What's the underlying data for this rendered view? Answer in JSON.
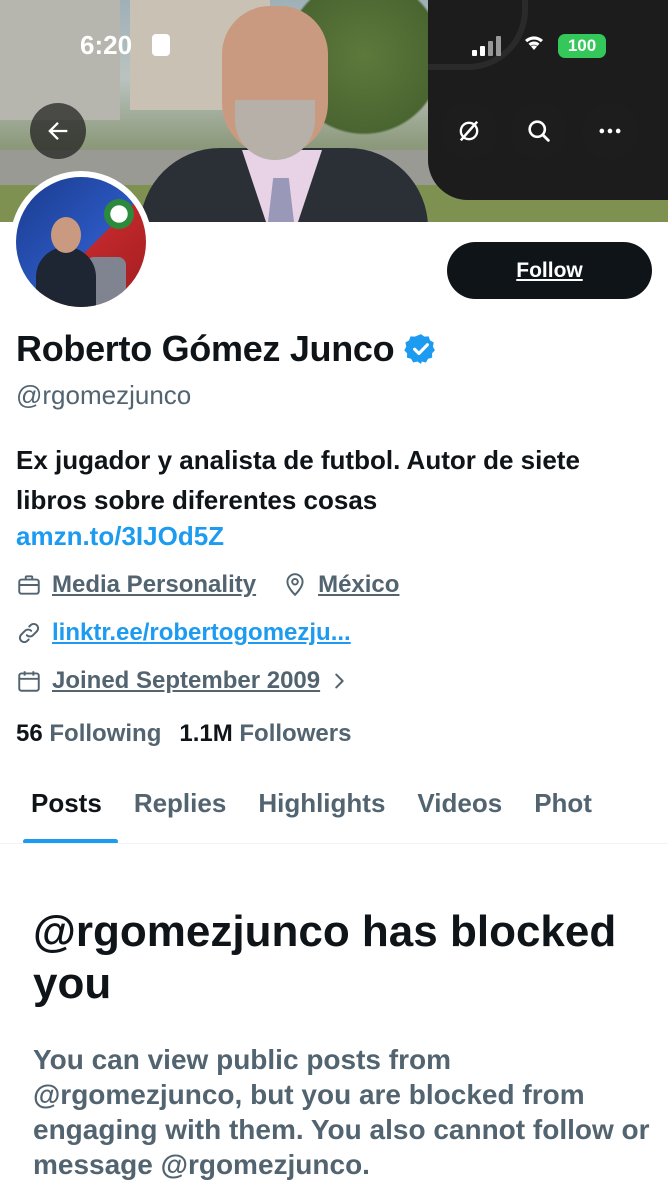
{
  "status_bar": {
    "time": "6:20",
    "battery": "100"
  },
  "header": {
    "back_icon": "arrow-left-icon",
    "icons": [
      "grok-icon",
      "search-icon",
      "more-icon"
    ]
  },
  "profile": {
    "name": "Roberto Gómez Junco",
    "verified": true,
    "handle": "@rgomezjunco",
    "bio": "Ex jugador y analista de futbol. Autor de siete libros sobre diferentes cosas",
    "bio_link": "amzn.to/3IJOd5Z",
    "category": "Media Personality",
    "location": "México",
    "website": "linktr.ee/robertogomezju...",
    "joined": "Joined September 2009",
    "following_count": "56",
    "following_label": "Following",
    "followers_count": "1.1M",
    "followers_label": "Followers"
  },
  "actions": {
    "follow_label": "Follow"
  },
  "tabs": [
    {
      "label": "Posts",
      "active": true
    },
    {
      "label": "Replies",
      "active": false
    },
    {
      "label": "Highlights",
      "active": false
    },
    {
      "label": "Videos",
      "active": false
    },
    {
      "label": "Phot",
      "active": false
    }
  ],
  "blocked": {
    "title": "@rgomezjunco has blocked you",
    "text": "You can view public posts from @rgomezjunco, but you are blocked from engaging with them. You also cannot follow or message @rgomezjunco."
  },
  "colors": {
    "accent": "#1d9bf0",
    "text_primary": "#0f1419",
    "text_secondary": "#536471",
    "battery": "#34c759"
  }
}
